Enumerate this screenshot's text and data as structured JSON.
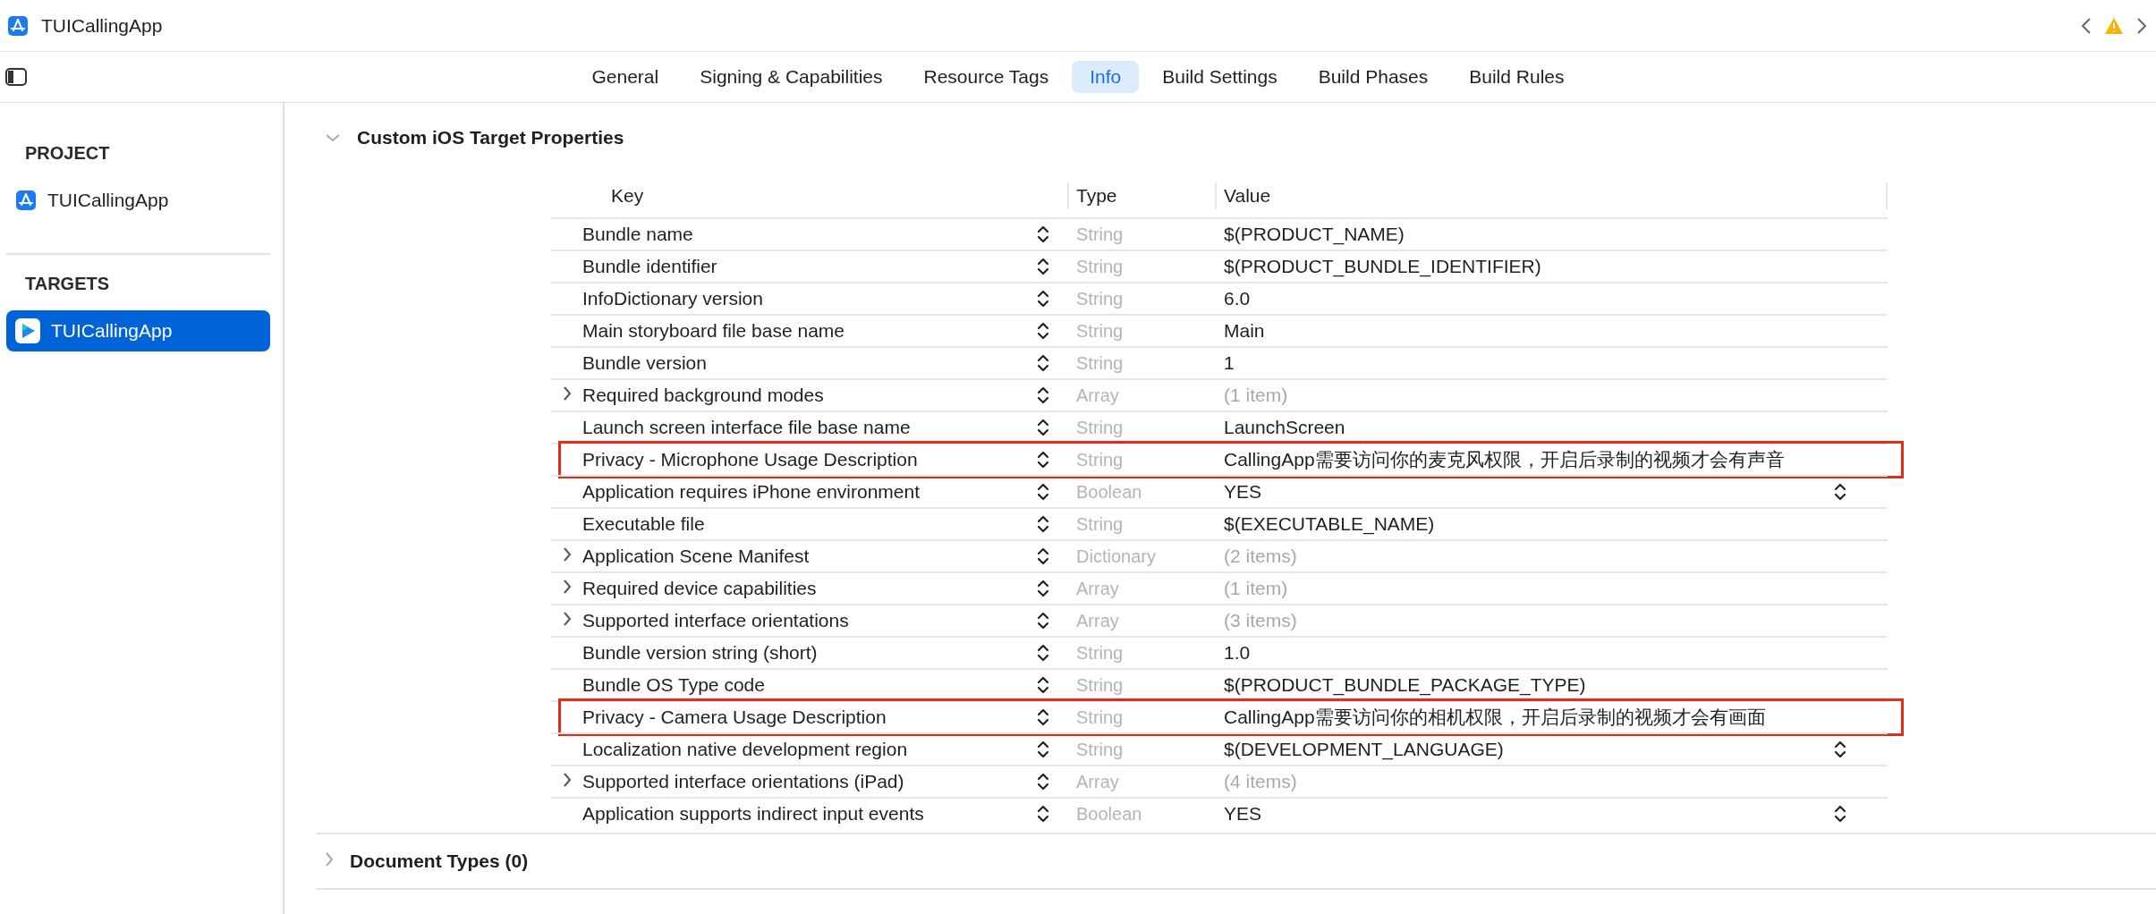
{
  "window": {
    "title": "TUICallingApp"
  },
  "tabs": [
    {
      "label": "General",
      "selected": false
    },
    {
      "label": "Signing & Capabilities",
      "selected": false
    },
    {
      "label": "Resource Tags",
      "selected": false
    },
    {
      "label": "Info",
      "selected": true
    },
    {
      "label": "Build Settings",
      "selected": false
    },
    {
      "label": "Build Phases",
      "selected": false
    },
    {
      "label": "Build Rules",
      "selected": false
    }
  ],
  "sidebar": {
    "groups": [
      {
        "title": "PROJECT",
        "items": [
          {
            "label": "TUICallingApp",
            "kind": "project",
            "selected": false
          }
        ]
      },
      {
        "title": "TARGETS",
        "items": [
          {
            "label": "TUICallingApp",
            "kind": "target",
            "selected": true
          }
        ]
      }
    ]
  },
  "sections": [
    {
      "title": "Custom iOS Target Properties",
      "expanded": true,
      "table": {
        "columns": [
          "Key",
          "Type",
          "Value"
        ],
        "rows": [
          {
            "key": "Bundle name",
            "type": "String",
            "value": "$(PRODUCT_NAME)",
            "kind": "item",
            "popup": false,
            "highlighted": false
          },
          {
            "key": "Bundle identifier",
            "type": "String",
            "value": "$(PRODUCT_BUNDLE_IDENTIFIER)",
            "kind": "item",
            "popup": false,
            "highlighted": false
          },
          {
            "key": "InfoDictionary version",
            "type": "String",
            "value": "6.0",
            "kind": "item",
            "popup": false,
            "highlighted": false
          },
          {
            "key": "Main storyboard file base name",
            "type": "String",
            "value": "Main",
            "kind": "item",
            "popup": false,
            "highlighted": false
          },
          {
            "key": "Bundle version",
            "type": "String",
            "value": "1",
            "kind": "item",
            "popup": false,
            "highlighted": false
          },
          {
            "key": "Required background modes",
            "type": "Array",
            "value": "(1 item)",
            "kind": "group",
            "expanded": false,
            "popup": false,
            "highlighted": false
          },
          {
            "key": "Launch screen interface file base name",
            "type": "String",
            "value": "LaunchScreen",
            "kind": "item",
            "popup": false,
            "highlighted": false
          },
          {
            "key": "Privacy - Microphone Usage Description",
            "type": "String",
            "value": "CallingApp需要访问你的麦克风权限，开启后录制的视频才会有声音",
            "kind": "item",
            "popup": false,
            "highlighted": true
          },
          {
            "key": "Application requires iPhone environment",
            "type": "Boolean",
            "value": "YES",
            "kind": "item",
            "popup": true,
            "highlighted": false
          },
          {
            "key": "Executable file",
            "type": "String",
            "value": "$(EXECUTABLE_NAME)",
            "kind": "item",
            "popup": false,
            "highlighted": false
          },
          {
            "key": "Application Scene Manifest",
            "type": "Dictionary",
            "value": "(2 items)",
            "kind": "group",
            "expanded": false,
            "popup": false,
            "highlighted": false
          },
          {
            "key": "Required device capabilities",
            "type": "Array",
            "value": "(1 item)",
            "kind": "group",
            "expanded": false,
            "popup": false,
            "highlighted": false
          },
          {
            "key": "Supported interface orientations",
            "type": "Array",
            "value": "(3 items)",
            "kind": "group",
            "expanded": false,
            "popup": false,
            "highlighted": false
          },
          {
            "key": "Bundle version string (short)",
            "type": "String",
            "value": "1.0",
            "kind": "item",
            "popup": false,
            "highlighted": false
          },
          {
            "key": "Bundle OS Type code",
            "type": "String",
            "value": "$(PRODUCT_BUNDLE_PACKAGE_TYPE)",
            "kind": "item",
            "popup": false,
            "highlighted": false
          },
          {
            "key": "Privacy - Camera Usage Description",
            "type": "String",
            "value": "CallingApp需要访问你的相机权限，开启后录制的视频才会有画面",
            "kind": "item",
            "popup": false,
            "highlighted": true
          },
          {
            "key": "Localization native development region",
            "type": "String",
            "value": "$(DEVELOPMENT_LANGUAGE)",
            "kind": "item",
            "popup": true,
            "highlighted": false
          },
          {
            "key": "Supported interface orientations (iPad)",
            "type": "Array",
            "value": "(4 items)",
            "kind": "group",
            "expanded": false,
            "popup": false,
            "highlighted": false
          },
          {
            "key": "Application supports indirect input events",
            "type": "Boolean",
            "value": "YES",
            "kind": "item",
            "popup": true,
            "highlighted": false
          }
        ]
      }
    },
    {
      "title": "Document Types (0)",
      "expanded": false
    }
  ]
}
